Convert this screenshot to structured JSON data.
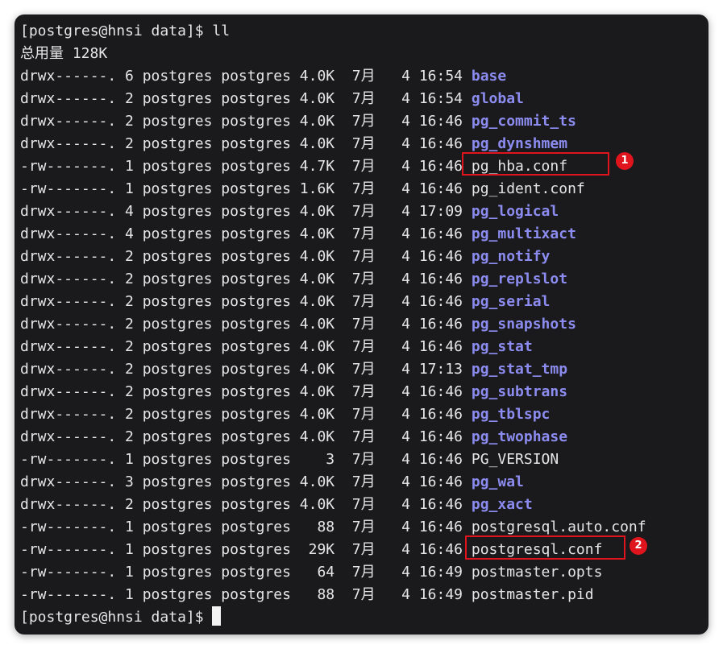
{
  "terminal": {
    "prompt_command": "[postgres@hnsi data]$ ll",
    "total_line": "总用量 128K",
    "prompt_final": "[postgres@hnsi data]$ ",
    "entries": [
      {
        "meta": "drwx------. 6 postgres postgres 4.0K  7月   4 16:54 ",
        "name": "base",
        "type": "dir"
      },
      {
        "meta": "drwx------. 2 postgres postgres 4.0K  7月   4 16:54 ",
        "name": "global",
        "type": "dir"
      },
      {
        "meta": "drwx------. 2 postgres postgres 4.0K  7月   4 16:46 ",
        "name": "pg_commit_ts",
        "type": "dir"
      },
      {
        "meta": "drwx------. 2 postgres postgres 4.0K  7月   4 16:46 ",
        "name": "pg_dynshmem",
        "type": "dir"
      },
      {
        "meta": "-rw-------. 1 postgres postgres 4.7K  7月   4 16:46 ",
        "name": "pg_hba.conf",
        "type": "file"
      },
      {
        "meta": "-rw-------. 1 postgres postgres 1.6K  7月   4 16:46 ",
        "name": "pg_ident.conf",
        "type": "file"
      },
      {
        "meta": "drwx------. 4 postgres postgres 4.0K  7月   4 17:09 ",
        "name": "pg_logical",
        "type": "dir"
      },
      {
        "meta": "drwx------. 4 postgres postgres 4.0K  7月   4 16:46 ",
        "name": "pg_multixact",
        "type": "dir"
      },
      {
        "meta": "drwx------. 2 postgres postgres 4.0K  7月   4 16:46 ",
        "name": "pg_notify",
        "type": "dir"
      },
      {
        "meta": "drwx------. 2 postgres postgres 4.0K  7月   4 16:46 ",
        "name": "pg_replslot",
        "type": "dir"
      },
      {
        "meta": "drwx------. 2 postgres postgres 4.0K  7月   4 16:46 ",
        "name": "pg_serial",
        "type": "dir"
      },
      {
        "meta": "drwx------. 2 postgres postgres 4.0K  7月   4 16:46 ",
        "name": "pg_snapshots",
        "type": "dir"
      },
      {
        "meta": "drwx------. 2 postgres postgres 4.0K  7月   4 16:46 ",
        "name": "pg_stat",
        "type": "dir"
      },
      {
        "meta": "drwx------. 2 postgres postgres 4.0K  7月   4 17:13 ",
        "name": "pg_stat_tmp",
        "type": "dir"
      },
      {
        "meta": "drwx------. 2 postgres postgres 4.0K  7月   4 16:46 ",
        "name": "pg_subtrans",
        "type": "dir"
      },
      {
        "meta": "drwx------. 2 postgres postgres 4.0K  7月   4 16:46 ",
        "name": "pg_tblspc",
        "type": "dir"
      },
      {
        "meta": "drwx------. 2 postgres postgres 4.0K  7月   4 16:46 ",
        "name": "pg_twophase",
        "type": "dir"
      },
      {
        "meta": "-rw-------. 1 postgres postgres    3  7月   4 16:46 ",
        "name": "PG_VERSION",
        "type": "file"
      },
      {
        "meta": "drwx------. 3 postgres postgres 4.0K  7月   4 16:46 ",
        "name": "pg_wal",
        "type": "dir"
      },
      {
        "meta": "drwx------. 2 postgres postgres 4.0K  7月   4 16:46 ",
        "name": "pg_xact",
        "type": "dir"
      },
      {
        "meta": "-rw-------. 1 postgres postgres   88  7月   4 16:46 ",
        "name": "postgresql.auto.conf",
        "type": "file"
      },
      {
        "meta": "-rw-------. 1 postgres postgres  29K  7月   4 16:46 ",
        "name": "postgresql.conf",
        "type": "file"
      },
      {
        "meta": "-rw-------. 1 postgres postgres   64  7月   4 16:49 ",
        "name": "postmaster.opts",
        "type": "file"
      },
      {
        "meta": "-rw-------. 1 postgres postgres   88  7月   4 16:49 ",
        "name": "postmaster.pid",
        "type": "file"
      }
    ]
  },
  "annotations": [
    {
      "label": "1",
      "target": "pg_hba.conf"
    },
    {
      "label": "2",
      "target": "postgresql.conf"
    }
  ],
  "colors": {
    "background": "#1a1a1d",
    "text": "#e6e6e6",
    "directory": "#8c8cf0",
    "highlight": "#e0141c"
  }
}
